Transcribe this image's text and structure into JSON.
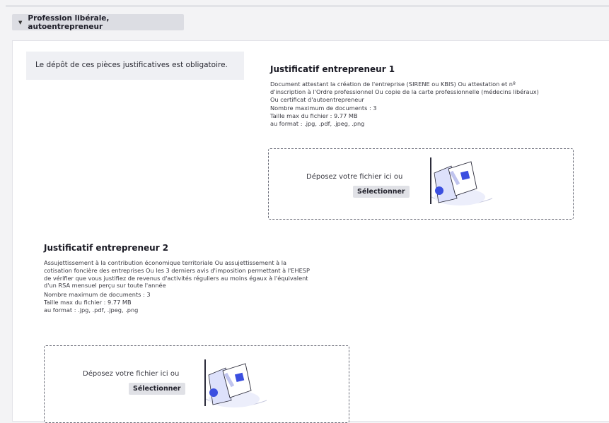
{
  "section": {
    "title": "Profession libérale, autoentrepreneur",
    "toggle_icon": "chevron-down-icon"
  },
  "note": "Le dépôt de ces pièces justificatives est obligatoire.",
  "justificatifs": [
    {
      "title": "Justificatif entrepreneur 1",
      "description": "Document attestant la création de l'entreprise (SIRENE ou KBIS) Ou attestation et nº d'inscription à l'Ordre professionnel Ou copie de la carte professionnelle (médecins libéraux) Ou certificat d'autoentrepreneur",
      "max_docs": "Nombre maximum de documents : 3",
      "max_size": "Taille max du fichier : 9.77 MB",
      "formats": "au format : .jpg, .pdf, .jpeg, .png",
      "drop_text": "Déposez votre fichier ici ou",
      "select_label": "Sélectionner"
    },
    {
      "title": "Justificatif entrepreneur 2",
      "description": "Assujettissement à la contribution économique territoriale Ou assujettissement à la cotisation foncière des entreprises Ou les 3 derniers avis d'imposition permettant à l'EHESP de vérifier que vous justifiez de revenus d'activités réguliers au moins égaux à l'équivalent d'un RSA mensuel perçu sur toute l'année",
      "max_docs": "Nombre maximum de documents : 3",
      "max_size": "Taille max du fichier : 9.77 MB",
      "formats": "au format : .jpg, .pdf, .jpeg, .png",
      "drop_text": "Déposez votre fichier ici ou",
      "select_label": "Sélectionner"
    }
  ],
  "colors": {
    "accent": "#3b4fe0",
    "illustration_light": "#e6e8fb",
    "panel": "#ffffff",
    "background": "#f3f3f5"
  }
}
